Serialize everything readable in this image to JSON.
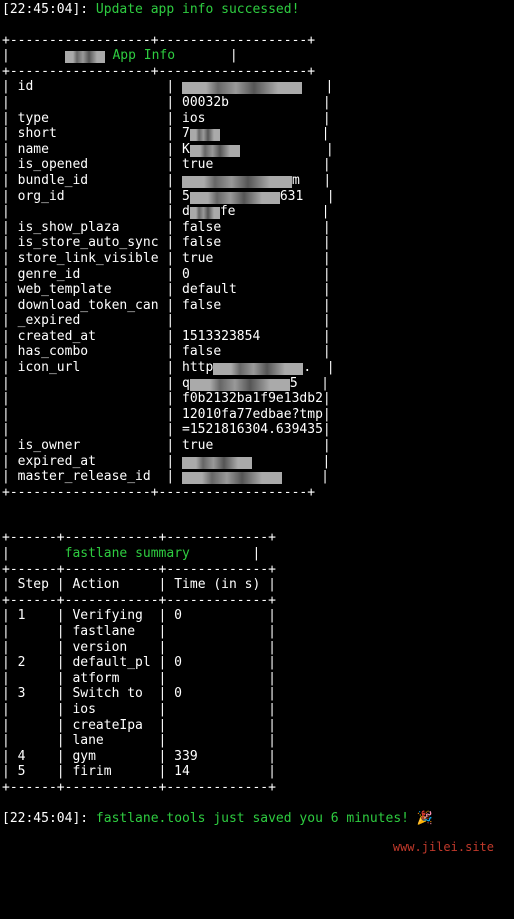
{
  "top": {
    "timestamp": "[22:45:04]:",
    "message": "Update app info successed!"
  },
  "table1": {
    "border_top": "+------------------+-------------------+",
    "border_hdr": "+------------------+-------------------+",
    "border_mid": "+------------------+-------------------+",
    "border_bot": "+------------------+-------------------+",
    "header_prefix": "|       ",
    "header_redact_w": 40,
    "header_title": " App Info",
    "header_pad": "       |",
    "rows": [
      {
        "k": "id",
        "v_redact_w": 120,
        "v_suffix": ""
      },
      {
        "k": "",
        "v_text": "00032b"
      },
      {
        "k": "type",
        "v_text": "ios"
      },
      {
        "k": "short",
        "v_redact_w": 30,
        "v_prefix": "7"
      },
      {
        "k": "name",
        "v_redact_w": 50,
        "v_prefix": "K"
      },
      {
        "k": "is_opened",
        "v_text": "true"
      },
      {
        "k": "bundle_id",
        "v_redact_w": 110,
        "v_suffix": "m"
      },
      {
        "k": "org_id",
        "v_redact_w": 90,
        "v_prefix": "5",
        "v_suffix": "631"
      },
      {
        "k": "",
        "v_redact_w": 30,
        "v_prefix": "d",
        "v_suffix": "fe"
      },
      {
        "k": "is_show_plaza",
        "v_text": "false"
      },
      {
        "k": "is_store_auto_sync",
        "v_text": "false"
      },
      {
        "k": "store_link_visible",
        "v_text": "true"
      },
      {
        "k": "genre_id",
        "v_text": "0"
      },
      {
        "k": "web_template",
        "v_text": "default"
      },
      {
        "k": "download_token_can",
        "v_text": "false"
      },
      {
        "k": "_expired",
        "v_text": ""
      },
      {
        "k": "created_at",
        "v_text": "1513323854"
      },
      {
        "k": "has_combo",
        "v_text": "false"
      },
      {
        "k": "icon_url",
        "v_redact_w": 90,
        "v_prefix": "http",
        "v_suffix": "."
      },
      {
        "k": "",
        "v_redact_w": 100,
        "v_prefix": "q",
        "v_suffix": "5"
      },
      {
        "k": "",
        "v_text": "f0b2132ba1f9e13db2"
      },
      {
        "k": "",
        "v_text": "12010fa77edbae?tmp"
      },
      {
        "k": "",
        "v_text": "=1521816304.639435"
      },
      {
        "k": "is_owner",
        "v_text": "true"
      },
      {
        "k": "expired_at",
        "v_redact_w": 70,
        "v_prefix": ""
      },
      {
        "k": "master_release_id",
        "v_redact_w": 100,
        "v_prefix": ""
      }
    ]
  },
  "table2": {
    "border_top": "+------+------------+-------------+",
    "border_mid": "+------+------------+-------------+",
    "border_bot": "+------+------------+-------------+",
    "header_pre": "|       ",
    "header_title": "fastlane summary",
    "header_pad": "        |",
    "col_headers": {
      "c1": "Step",
      "c2": "Action",
      "c3": "Time (in s)"
    },
    "rows": [
      {
        "c1": "1",
        "c2": "Verifying",
        "c3": "0"
      },
      {
        "c1": "",
        "c2": "fastlane",
        "c3": ""
      },
      {
        "c1": "",
        "c2": "version",
        "c3": ""
      },
      {
        "c1": "2",
        "c2": "default_pl",
        "c3": "0"
      },
      {
        "c1": "",
        "c2": "atform",
        "c3": ""
      },
      {
        "c1": "3",
        "c2": "Switch to",
        "c3": "0"
      },
      {
        "c1": "",
        "c2": "ios",
        "c3": ""
      },
      {
        "c1": "",
        "c2": "createIpa",
        "c3": ""
      },
      {
        "c1": "",
        "c2": "lane",
        "c3": ""
      },
      {
        "c1": "4",
        "c2": "gym",
        "c3": "339"
      },
      {
        "c1": "5",
        "c2": "firim",
        "c3": "14"
      }
    ]
  },
  "bottom": {
    "timestamp": "[22:45:04]:",
    "message": "fastlane.tools just saved you 6 minutes!",
    "emoji": "🎉"
  },
  "watermark": "www.jilei.site"
}
